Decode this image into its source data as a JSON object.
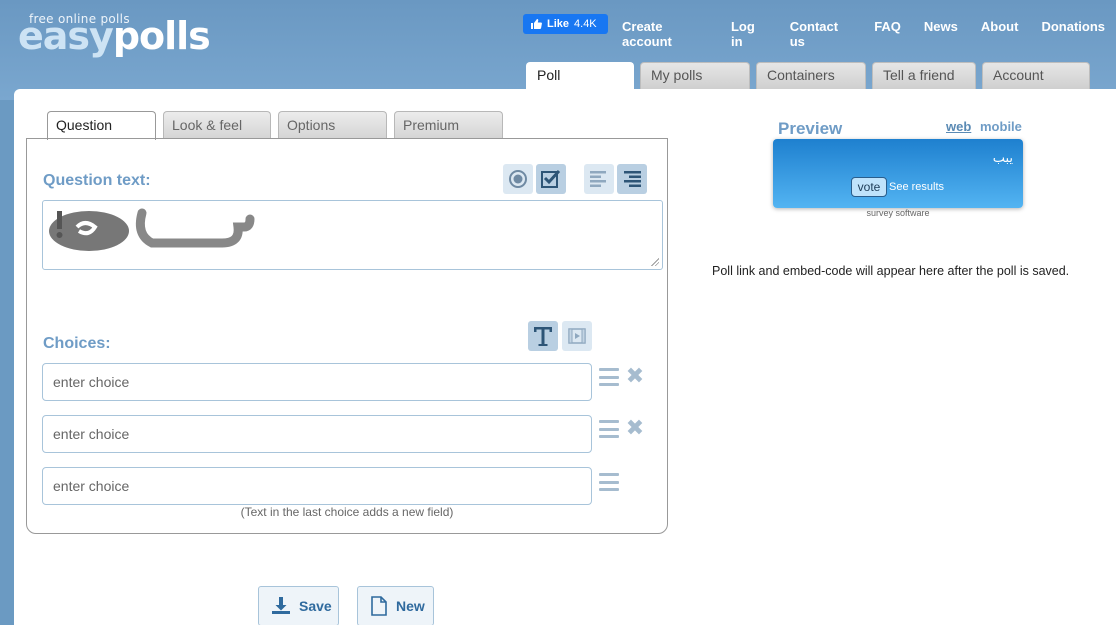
{
  "brand": {
    "tagline": "free online polls",
    "part1": "easy",
    "part2": "polls"
  },
  "facebook": {
    "label": "Like",
    "count": "4.4K"
  },
  "topnav": [
    "Create account",
    "Log in",
    "Contact us",
    "FAQ",
    "News",
    "About",
    "Donations"
  ],
  "maintabs": [
    "Poll",
    "My polls",
    "Containers",
    "Tell a friend",
    "Account"
  ],
  "subtabs": [
    "Question",
    "Look & feel",
    "Options",
    "Premium"
  ],
  "question": {
    "label": "Question text:"
  },
  "choices": {
    "label": "Choices:",
    "placeholder": "enter choice",
    "hint": "(Text in the last choice adds a new field)"
  },
  "buttons": {
    "save": "Save",
    "new": "New"
  },
  "preview": {
    "title": "Preview",
    "web": "web",
    "mobile": "mobile",
    "question": "يبب",
    "vote": "vote",
    "see_results": "See results",
    "credit": "survey software"
  },
  "poll_message": "Poll link and embed-code will appear here after the poll is saved.",
  "colors": {
    "accent": "#6f9cc6",
    "header_bg": "#6b9ac2",
    "widget": "#1e80cf"
  }
}
